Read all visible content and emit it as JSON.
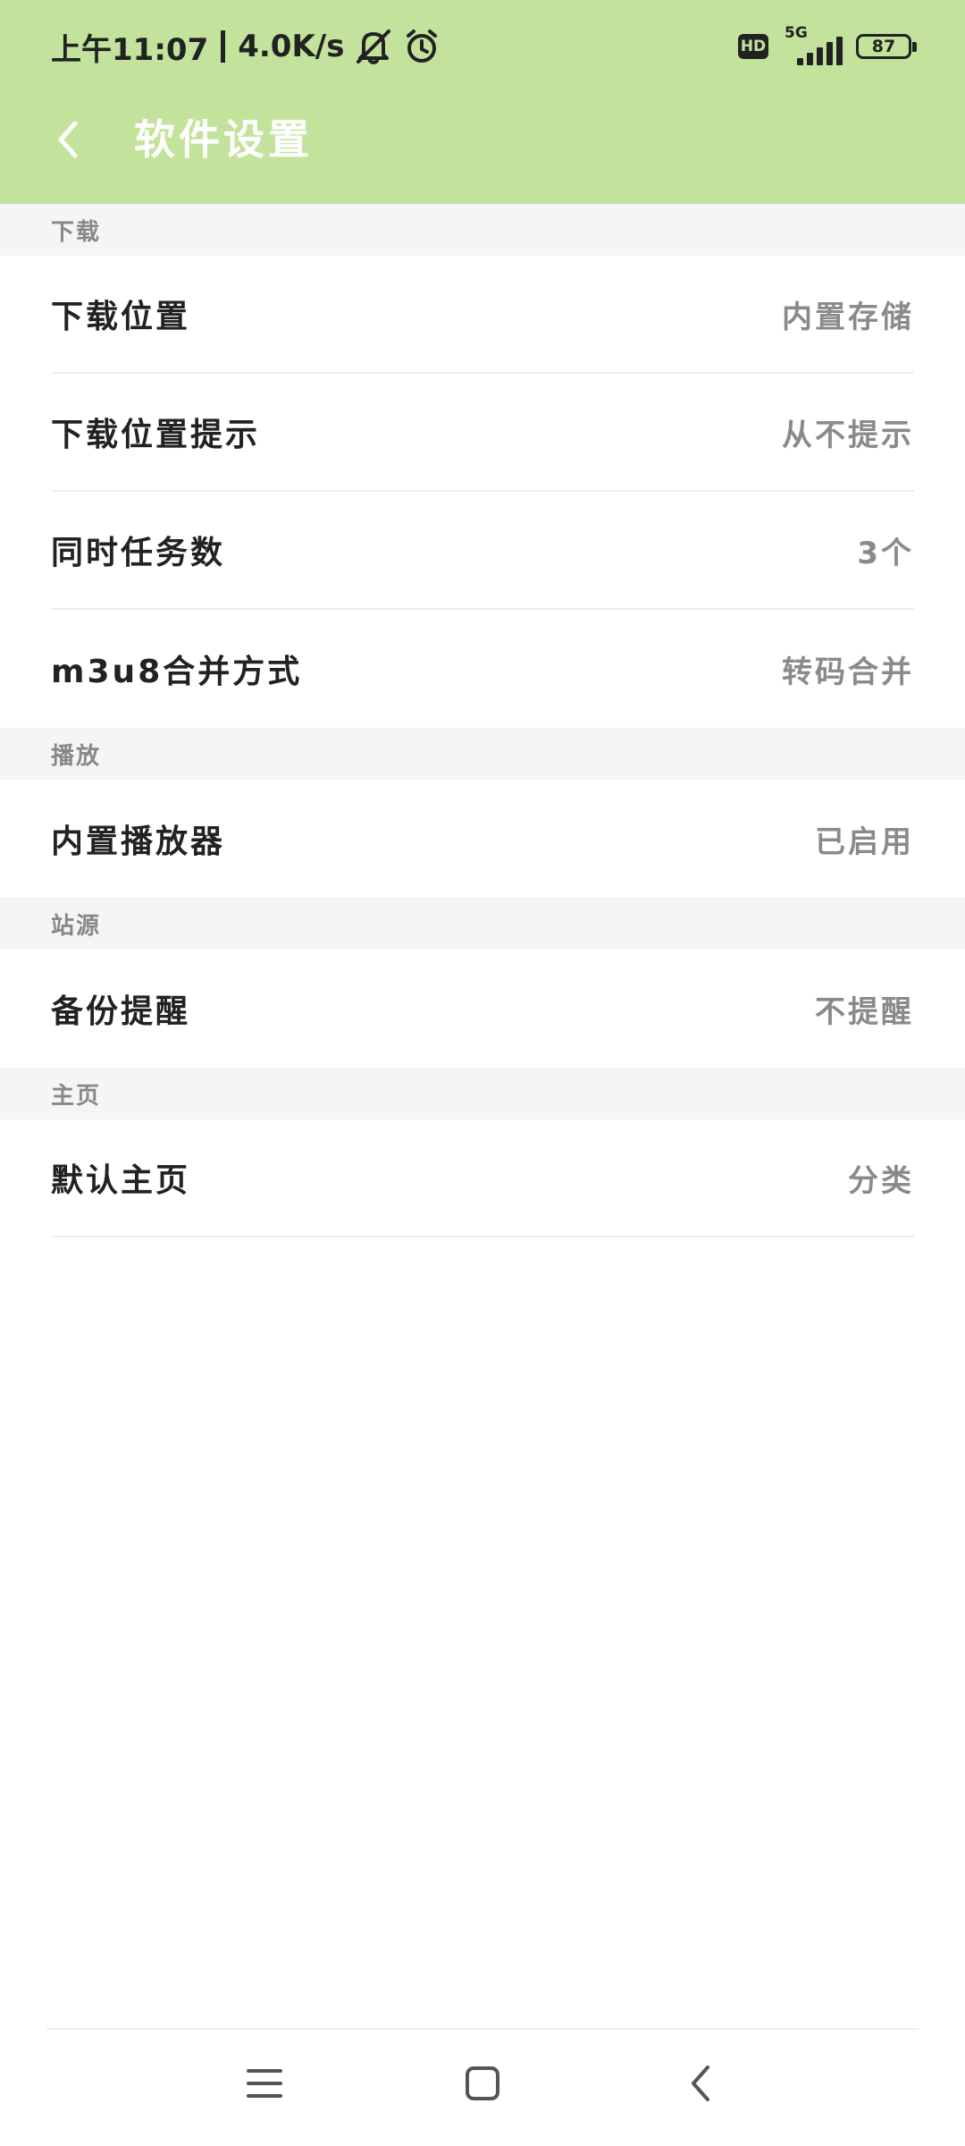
{
  "status_bar": {
    "time": "上午11:07",
    "speed": "4.0K/s",
    "hd_label": "HD",
    "network_type": "5G",
    "battery": "87",
    "icons": [
      "mute-icon",
      "alarm-icon",
      "hd-icon",
      "signal-icon",
      "battery-icon"
    ]
  },
  "app_bar": {
    "title": "软件设置",
    "back_icon": "chevron-left-icon",
    "background_color": "#c3e39d"
  },
  "sections": [
    {
      "header": "下载",
      "items": [
        {
          "label": "下载位置",
          "value": "内置存储"
        },
        {
          "label": "下载位置提示",
          "value": "从不提示"
        },
        {
          "label": "同时任务数",
          "value": "3个"
        },
        {
          "label": "m3u8合并方式",
          "value": "转码合并"
        }
      ]
    },
    {
      "header": "播放",
      "items": [
        {
          "label": "内置播放器",
          "value": "已启用"
        }
      ]
    },
    {
      "header": "站源",
      "items": [
        {
          "label": "备份提醒",
          "value": "不提醒"
        }
      ]
    },
    {
      "header": "主页",
      "items": [
        {
          "label": "默认主页",
          "value": "分类"
        }
      ]
    }
  ],
  "nav_bar": {
    "icons": [
      "menu-icon",
      "home-square-icon",
      "back-chevron-icon"
    ]
  }
}
